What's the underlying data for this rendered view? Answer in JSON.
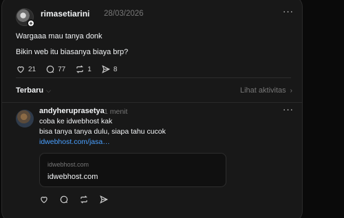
{
  "post": {
    "author": "rimasetiarini",
    "date": "28/03/2026",
    "more": "···",
    "lines": [
      "Wargaaa mau tanya donk",
      "Bikin web itu biasanya biaya brp?"
    ],
    "stats": {
      "likes": "21",
      "comments": "77",
      "reposts": "1",
      "shares": "8"
    }
  },
  "sort": {
    "label": "Terbaru",
    "activity_label": "Lihat aktivitas"
  },
  "reply": {
    "author": "andyheruprasetya",
    "time": "1 menit",
    "more": "···",
    "lines": [
      "coba ke idwebhost kak",
      "bisa tanya tanya dulu, siapa tahu cucok"
    ],
    "link": "idwebhost.com/jasa…",
    "preview": {
      "domain": "idwebhost.com",
      "title": "idwebhost.com"
    }
  },
  "icons": {
    "like": "heart-icon",
    "comment": "comment-icon",
    "repost": "repost-icon",
    "share": "send-icon",
    "more": "more-icon",
    "chevron": "chevron-icon"
  },
  "colors": {
    "background": "#181818",
    "link": "#4aa0ff",
    "muted": "#777777"
  }
}
